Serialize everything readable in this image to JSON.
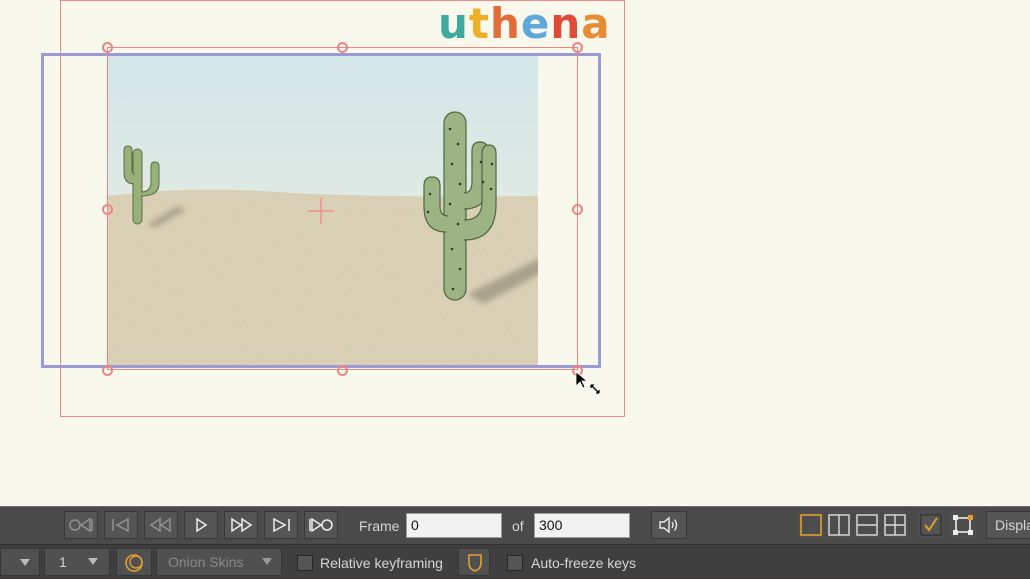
{
  "logo": {
    "text": "uthena",
    "letters": [
      {
        "ch": "u",
        "color": "#3daaa0"
      },
      {
        "ch": "t",
        "color": "#f0b024"
      },
      {
        "ch": "h",
        "color": "#e36d3a"
      },
      {
        "ch": "e",
        "color": "#5fa8d8"
      },
      {
        "ch": "n",
        "color": "#e04a3a"
      },
      {
        "ch": "a",
        "color": "#e98a35"
      }
    ]
  },
  "transport": {
    "buttons": [
      "rewind-to-start-icon",
      "step-back-key-icon",
      "step-back-frame-icon",
      "play-icon",
      "step-forward-frame-icon",
      "step-forward-key-icon",
      "forward-to-end-icon"
    ],
    "frame_label": "Frame",
    "frame_value": "0",
    "of_label": "of",
    "total_frames": "300",
    "display_label": "Display"
  },
  "options": {
    "layer_value": "1",
    "onion_skins_label": "Onion Skins",
    "relative_keyframing_label": "Relative keyframing",
    "relative_keyframing_checked": false,
    "auto_freeze_label": "Auto-freeze keys",
    "auto_freeze_checked": false
  },
  "colors": {
    "canvas_bg": "#f8f8ec",
    "selection_red": "#ee8585",
    "camera_blue": "#9a9bd6",
    "accent_orange": "#e0a030"
  }
}
